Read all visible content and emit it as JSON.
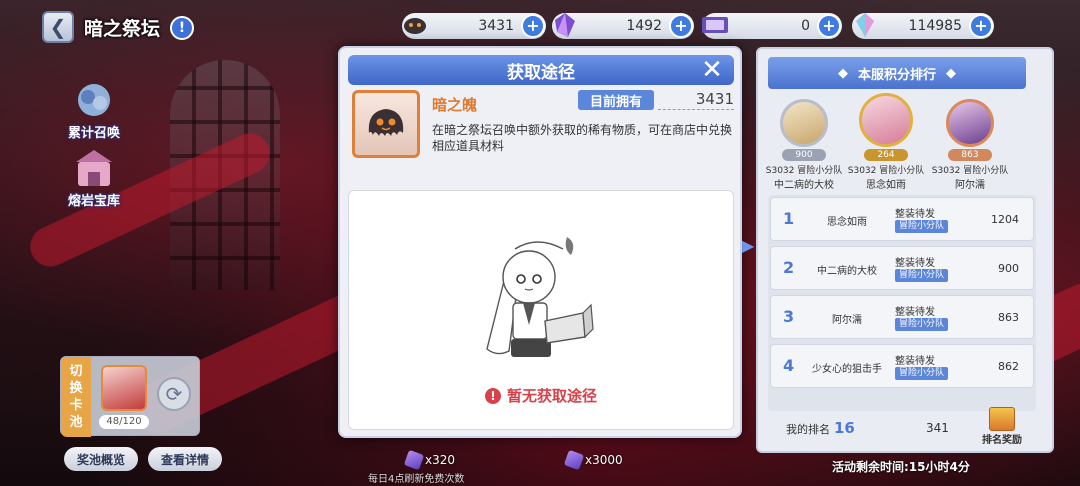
{
  "header": {
    "back_icon": "back-arrow-icon",
    "title": "暗之祭坛",
    "info_icon": "info-icon"
  },
  "resources": [
    {
      "icon": "dark-soul-icon",
      "value": "3431"
    },
    {
      "icon": "crystal-icon",
      "value": "1492"
    },
    {
      "icon": "ticket-icon",
      "value": "0"
    },
    {
      "icon": "gem-icon",
      "value": "114985"
    }
  ],
  "left_menu": [
    {
      "icon": "cumulative-summon-icon",
      "label": "累计召唤"
    },
    {
      "icon": "lava-vault-icon",
      "label": "熔岩宝库"
    }
  ],
  "pool": {
    "switch_label": [
      "切",
      "换",
      "卡",
      "池"
    ],
    "count": "48/120"
  },
  "bottom": {
    "prob_label": "奖池概览",
    "detail_label": "查看详情",
    "cost1": "x320",
    "cost2": "x3000",
    "daily_note": "每日4点刷新免费次数"
  },
  "modal": {
    "title": "获取途径",
    "item_icon": "dark-soul-icon",
    "item_name": "暗之魄",
    "own_label": "目前拥有",
    "own_value": "3431",
    "description": "在暗之祭坛召唤中额外获取的稀有物质，可在商店中兑换相应道具材料",
    "empty_text": "暂无获取途径"
  },
  "ranking": {
    "title": "本服积分排行",
    "top3": [
      {
        "score": "900",
        "team": "S3032 冒险小分队",
        "name": "中二病的大校",
        "frame": "#b9bdc9"
      },
      {
        "score": "264",
        "team": "S3032 冒险小分队",
        "name": "思念如雨",
        "frame": "#e0b040"
      },
      {
        "score": "863",
        "team": "S3032 冒险小分队",
        "name": "阿尔濡",
        "frame": "#d98a5a"
      }
    ],
    "rows": [
      {
        "rank": "1",
        "name": "思念如雨",
        "team": "整装待发",
        "tag": "冒险小分队",
        "score": "1204"
      },
      {
        "rank": "2",
        "name": "中二病的大校",
        "team": "整装待发",
        "tag": "冒险小分队",
        "score": "900"
      },
      {
        "rank": "3",
        "name": "阿尔濡",
        "team": "整装待发",
        "tag": "冒险小分队",
        "score": "863"
      },
      {
        "rank": "4",
        "name": "少女心的狙击手",
        "team": "整装待发",
        "tag": "冒险小分队",
        "score": "862"
      }
    ],
    "my_rank_label": "我的排名",
    "my_rank": "16",
    "my_score": "341",
    "reward_label": "排名奖励"
  },
  "timer": "活动剩余时间:15小时4分"
}
